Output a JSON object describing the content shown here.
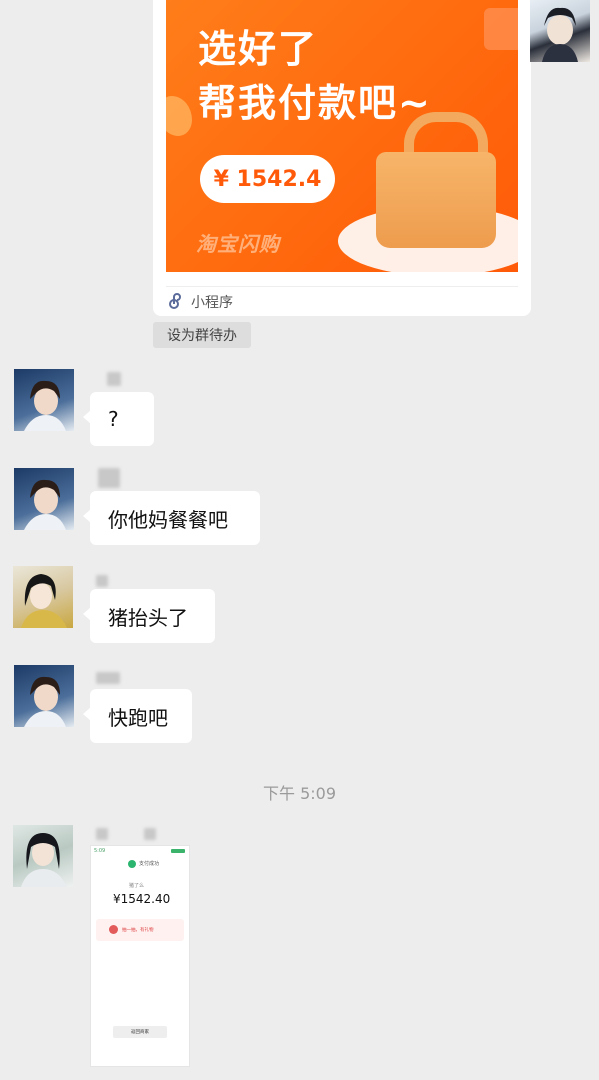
{
  "mini_program": {
    "headline_line1": "选好了",
    "headline_line2": "帮我付款吧~",
    "price": "¥ 1542.4",
    "brand_watermark": "淘宝闪购",
    "footer_label": "小程序",
    "icon": "link-icon"
  },
  "todo_chip": "设为群待办",
  "messages": [
    {
      "text": "?"
    },
    {
      "text": "你他妈餐餐吧"
    },
    {
      "text": "猪抬头了"
    },
    {
      "text": "快跑吧"
    }
  ],
  "time_divider": "下午 5:09",
  "payment_screenshot": {
    "status": "5:09",
    "title": "支付成功",
    "subtitle": "猪了么",
    "amount": "¥1542.40",
    "promo": "抽一抽，有礼物",
    "button": "返回商家"
  },
  "colors": {
    "background": "#ededed",
    "bubble": "#ffffff",
    "banner_orange": "#ff6a0e",
    "success_green": "#2bb56e"
  }
}
